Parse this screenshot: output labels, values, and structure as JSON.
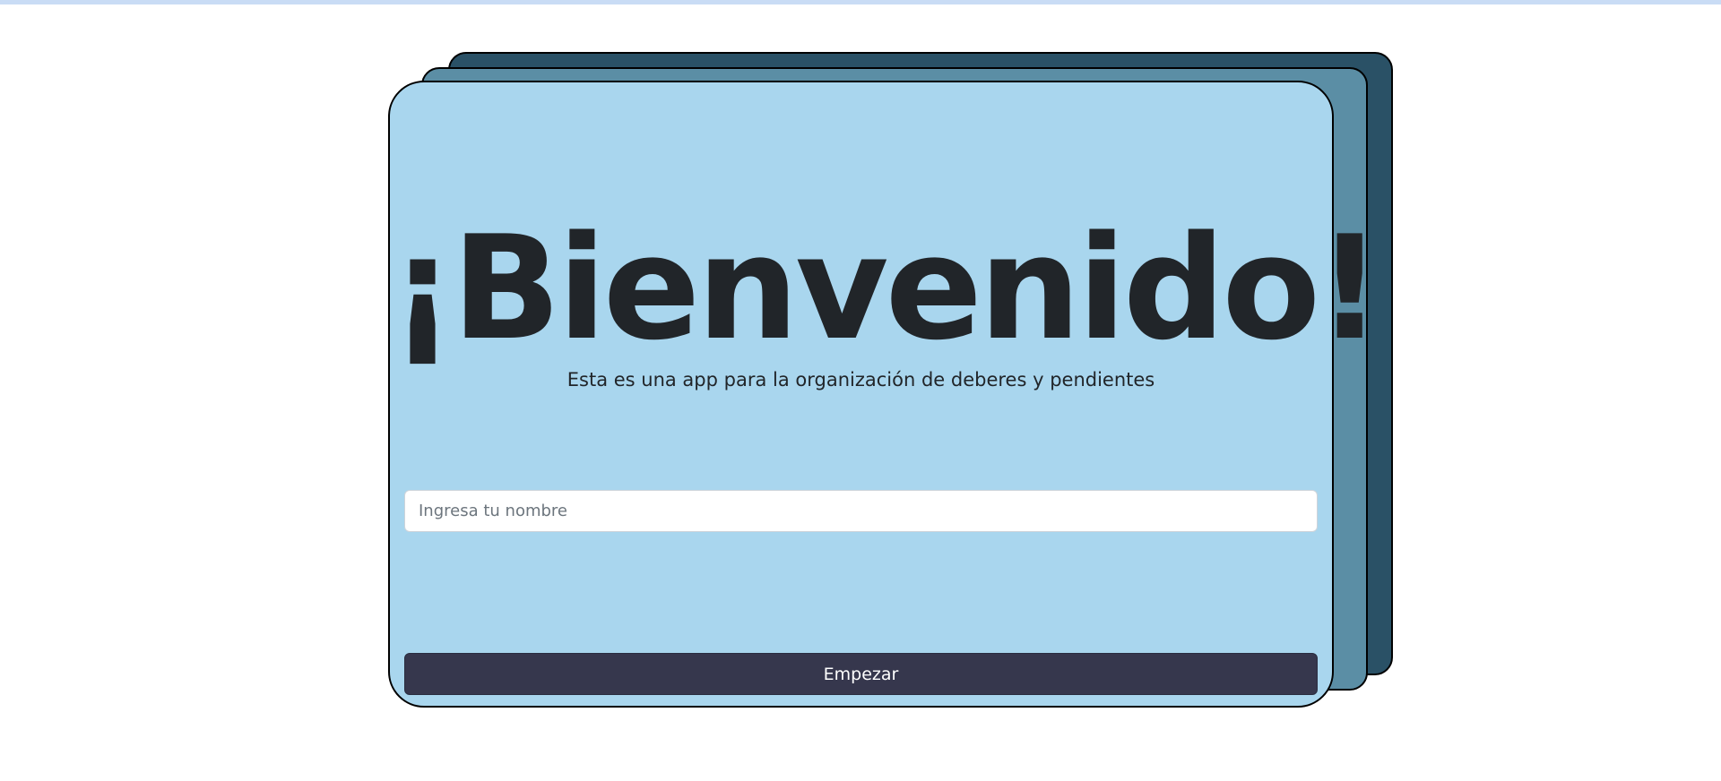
{
  "welcome": {
    "title": "¡Bienvenido!",
    "subtitle": "Esta es una app para la organización de deberes y pendientes",
    "name_input": {
      "value": "",
      "placeholder": "Ingresa tu nombre"
    },
    "start_button_label": "Empezar"
  },
  "colors": {
    "top_strip": "#c9dcf5",
    "card_back": "#2a5166",
    "card_middle": "#5b8ea5",
    "card_front": "#a9d6ee",
    "title_text": "#212529",
    "button_background": "#36374d",
    "button_text": "#ffffff"
  }
}
